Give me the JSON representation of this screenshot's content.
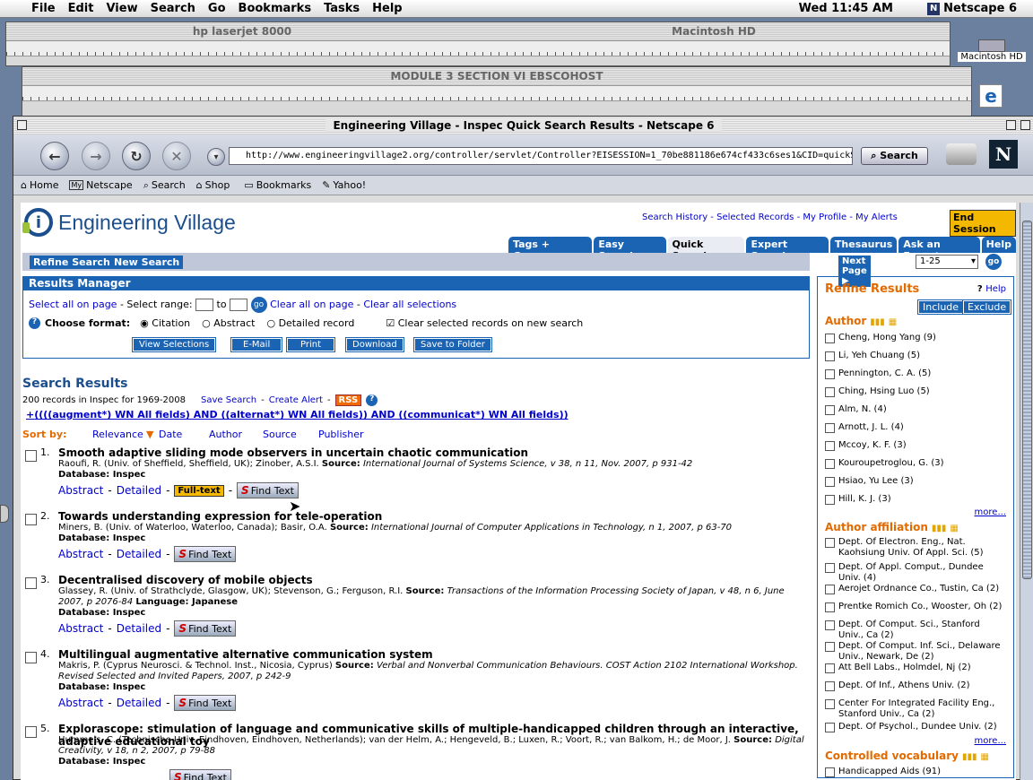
{
  "menubar": {
    "items": [
      "File",
      "Edit",
      "View",
      "Search",
      "Go",
      "Bookmarks",
      "Tasks",
      "Help"
    ],
    "clock": "Wed 11:45 AM",
    "app": "Netscape 6"
  },
  "bgwindows": {
    "printer": "hp laserjet 8000",
    "disk": "Macintosh HD",
    "doc": "MODULE 3 SECTION VI EBSCOHOST",
    "desktop_icon": "Macintosh HD"
  },
  "window": {
    "title": "Engineering Village - Inspec Quick Search Results - Netscape 6",
    "url": "http://www.engineeringvillage2.org/controller/servlet/Controller?EISESSION=1_70be881186e674cf433c6ses1&CID=quickSearch",
    "search_btn": "Search",
    "personal": [
      "Home",
      "Netscape",
      "Search",
      "Shop",
      "Bookmarks",
      "Yahoo!"
    ]
  },
  "site": {
    "logo": "Engineering Village",
    "top_links": [
      "Search History",
      "Selected Records",
      "My Profile",
      "My Alerts"
    ],
    "end_session": "End Session",
    "tabs": [
      "Tags + Groups",
      "Easy Search",
      "Quick Search",
      "Expert Search",
      "Thesaurus",
      "Ask an Expert",
      "Help"
    ],
    "refine_btn": "Refine Search",
    "new_btn": "New Search",
    "next_page": "Next Page",
    "page_range": "1-25",
    "go": "go"
  },
  "results_manager": {
    "title": "Results Manager",
    "select_all": "Select all on page",
    "select_range": "Select range:",
    "to": "to",
    "clear_page": "Clear all on page",
    "clear_all": "Clear all selections",
    "format_label": "Choose format:",
    "formats": [
      "Citation",
      "Abstract",
      "Detailed record"
    ],
    "clear_new": "Clear selected records on new search",
    "buttons": [
      "View Selections",
      "E-Mail",
      "Print",
      "Download",
      "Save to Folder"
    ]
  },
  "search": {
    "title": "Search Results",
    "count": "200 records in Inspec for 1969-2008",
    "save": "Save Search",
    "alert": "Create Alert",
    "rss": "RSS",
    "query": "((((augment*) WN All fields) AND ((alternat*) WN All fields)) AND ((communicat*) WN All fields))",
    "sort_by": "Sort by:",
    "sort": [
      "Relevance",
      "Date",
      "Author",
      "Source",
      "Publisher"
    ]
  },
  "records": [
    {
      "num": "1.",
      "title": "Smooth adaptive sliding mode observers in uncertain chaotic communication",
      "authors": "Raoufi, R. (Univ. of Sheffield, Sheffield, UK); Zinober, A.S.I.",
      "source_label": "Source:",
      "source": "International Journal of Systems Science, v 38, n 11, Nov. 2007, p 931-42",
      "db": "Database: Inspec",
      "actions": [
        "Abstract",
        "Detailed",
        "Full-text",
        "Find Text"
      ]
    },
    {
      "num": "2.",
      "title": "Towards understanding expression for tele-operation",
      "authors": "Miners, B. (Univ. of Waterloo, Waterloo, Canada); Basir, O.A.",
      "source_label": "Source:",
      "source": "International Journal of Computer Applications in Technology, n 1, 2007, p 63-70",
      "db": "Database: Inspec",
      "actions": [
        "Abstract",
        "Detailed",
        "Find Text"
      ]
    },
    {
      "num": "3.",
      "title": "Decentralised discovery of mobile objects",
      "authors": "Glassey, R. (Univ. of Strathclyde, Glasgow, UK); Stevenson, G.; Ferguson, R.I.",
      "source_label": "Source:",
      "source": "Transactions of the Information Processing Society of Japan, v 48, n 6, June 2007, p 2076-84",
      "lang": "Language: Japanese",
      "db": "Database: Inspec",
      "actions": [
        "Abstract",
        "Detailed",
        "Find Text"
      ]
    },
    {
      "num": "4.",
      "title": "Multilingual augmentative alternative communication system",
      "authors": "Makris, P. (Cyprus Neurosci. & Technol. Inst., Nicosia, Cyprus)",
      "source_label": "Source:",
      "source": "Verbal and Nonverbal Communication Behaviours. COST Action 2102 International Workshop. Revised Selected and Invited Papers, 2007, p 242-9",
      "db": "Database: Inspec",
      "actions": [
        "Abstract",
        "Detailed",
        "Find Text"
      ]
    },
    {
      "num": "5.",
      "title": "Explorascope: stimulation of language and communicative skills of multiple-handicapped children through an interactive, adaptive educational toy",
      "authors": "Hummels, C. (Technische Univ. Eindhoven, Eindhoven, Netherlands); van der Helm, A.; Hengeveld, B.; Luxen, R.; Voort, R.; van Balkom, H.; de Moor, J.",
      "source_label": "Source:",
      "source": "Digital Creativity, v 18, n 2, 2007, p 79-88",
      "db": "Database: Inspec",
      "actions": [
        "Find Text"
      ]
    }
  ],
  "refine": {
    "title": "Refine Results",
    "help": "Help",
    "include": "Include",
    "exclude": "Exclude",
    "author_label": "Author",
    "authors": [
      "Cheng, Hong Yang (9)",
      "Li, Yeh Chuang (5)",
      "Pennington, C. A. (5)",
      "Ching, Hsing Luo (5)",
      "Alm, N. (4)",
      "Arnott, J. L. (4)",
      "Mccoy, K. F. (3)",
      "Kouroupetroglou, G. (3)",
      "Hsiao, Yu Lee (3)",
      "Hill, K. J. (3)"
    ],
    "more": "more...",
    "affil_label": "Author affiliation",
    "affiliations": [
      "Dept. Of Electron. Eng., Nat. Kaohsiung Univ. Of Appl. Sci. (5)",
      "Dept. Of Appl. Comput., Dundee Univ. (4)",
      "Aerojet Ordnance Co., Tustin, Ca (2)",
      "Prentke Romich Co., Wooster, Oh (2)",
      "Dept. Of Comput. Sci., Stanford Univ., Ca (2)",
      "Dept. Of Comput. Inf. Sci., Delaware Univ., Newark, De (2)",
      "Att Bell Labs., Holmdel, Nj (2)",
      "Dept. Of Inf., Athens Univ. (2)",
      "Center For Integrated Facility Eng., Stanford Univ., Ca (2)",
      "Dept. Of Psychol., Dundee Univ. (2)"
    ],
    "vocab_label": "Controlled vocabulary",
    "vocab": [
      "Handicapped Aids (91)"
    ]
  }
}
